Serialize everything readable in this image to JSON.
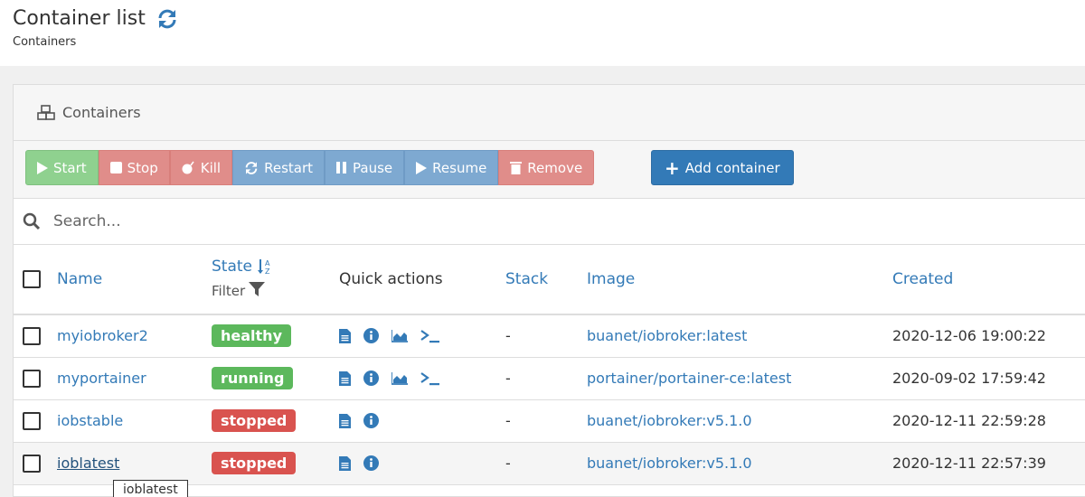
{
  "page": {
    "title": "Container list",
    "breadcrumb": "Containers",
    "refresh_icon": "refresh-icon"
  },
  "widget": {
    "title": "Containers",
    "title_icon": "cubes-icon"
  },
  "toolbar": {
    "start": "Start",
    "stop": "Stop",
    "kill": "Kill",
    "restart": "Restart",
    "pause": "Pause",
    "resume": "Resume",
    "remove": "Remove",
    "add": "Add container"
  },
  "search": {
    "placeholder": "Search..."
  },
  "columns": {
    "name": "Name",
    "state": "State",
    "state_filter": "Filter",
    "quick_actions": "Quick actions",
    "stack": "Stack",
    "image": "Image",
    "created": "Created"
  },
  "rows": [
    {
      "name": "myiobroker2",
      "state": "healthy",
      "stack": "-",
      "image": "buanet/iobroker:latest",
      "created": "2020-12-06 19:00:22"
    },
    {
      "name": "myportainer",
      "state": "running",
      "stack": "-",
      "image": "portainer/portainer-ce:latest",
      "created": "2020-09-02 17:59:42"
    },
    {
      "name": "iobstable",
      "state": "stopped",
      "stack": "-",
      "image": "buanet/iobroker:v5.1.0",
      "created": "2020-12-11 22:59:28"
    },
    {
      "name": "ioblatest",
      "state": "stopped",
      "stack": "-",
      "image": "buanet/iobroker:v5.1.0",
      "created": "2020-12-11 22:57:39"
    }
  ],
  "tooltip": "ioblatest",
  "colors": {
    "link": "#337ab7",
    "success": "#5cb85c",
    "danger": "#d9534f",
    "primary": "#337ab7"
  }
}
